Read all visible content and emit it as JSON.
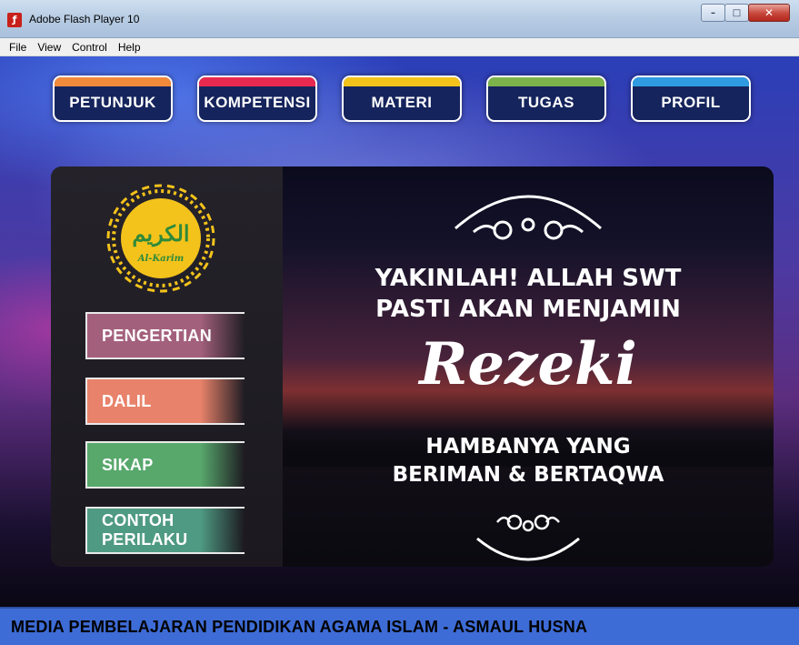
{
  "window": {
    "title": "Adobe Flash Player 10",
    "app_icon": "flash-player-icon",
    "controls": {
      "minimize": "–",
      "maximize": "□",
      "close": "✕"
    }
  },
  "menu": [
    "File",
    "View",
    "Control",
    "Help"
  ],
  "topnav": [
    {
      "label": "PETUNJUK",
      "accent": "#f28a3c"
    },
    {
      "label": "KOMPETENSI",
      "accent": "#e8294f"
    },
    {
      "label": "MATERI",
      "accent": "#f4c31b"
    },
    {
      "label": "TUGAS",
      "accent": "#7cb34a"
    },
    {
      "label": "PROFIL",
      "accent": "#2f9be0"
    }
  ],
  "logo": {
    "arabic": "الكريم",
    "latin": "Al-Karim",
    "color": "#f4c31b"
  },
  "sidebar": [
    {
      "label": "PENGERTIAN",
      "color": "#a3607c"
    },
    {
      "label": "DALIL",
      "color": "#e8826a"
    },
    {
      "label": "SIKAP",
      "color": "#58a86c"
    },
    {
      "label": "CONTOH PERILAKU",
      "color": "#4f9a82"
    }
  ],
  "quote": {
    "line1": "YAKINLAH! ALLAH SWT",
    "line2": "PASTI AKAN MENJAMIN",
    "highlight": "Rezeki",
    "line3": "HAMBANYA YANG",
    "line4": "BERIMAN & BERTAQWA"
  },
  "footer": "MEDIA PEMBELAJARAN PENDIDIKAN AGAMA ISLAM - ASMAUL HUSNA"
}
